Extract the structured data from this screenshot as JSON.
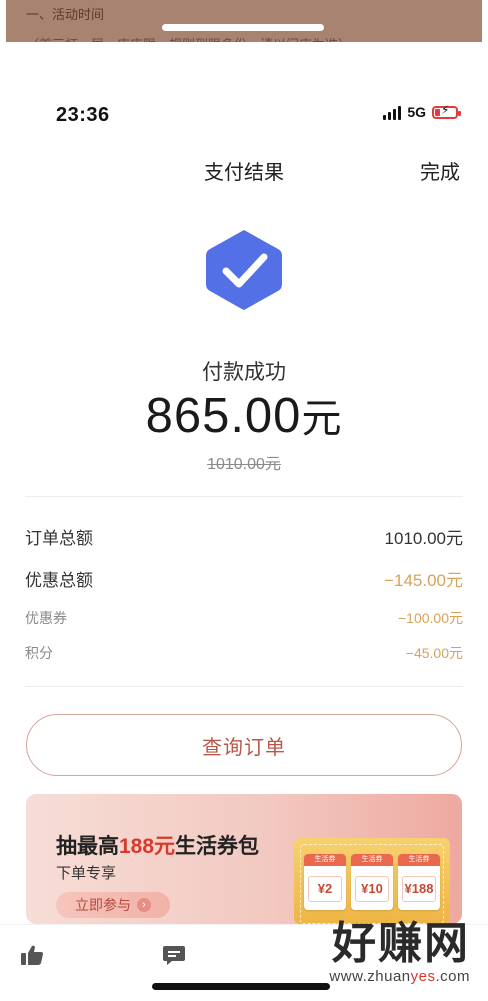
{
  "background_page": {
    "line1": "一、活动时间",
    "line2": "（首三杯一层，店店限，规则到限多份，请以门店为准）"
  },
  "status_bar": {
    "time": "23:36",
    "network": "5G"
  },
  "nav": {
    "title": "支付结果",
    "done": "完成"
  },
  "payment": {
    "status": "付款成功",
    "amount": "865.00",
    "unit": "元",
    "original": "1010.00元"
  },
  "details": [
    {
      "label": "订单总额",
      "value": "1010.00元"
    },
    {
      "label": "优惠总额",
      "value": "−145.00元"
    },
    {
      "label": "优惠券",
      "value": "−100.00元"
    },
    {
      "label": "积分",
      "value": "−45.00元"
    }
  ],
  "query_button": "查询订单",
  "promo": {
    "title_pre": "抽最高",
    "title_highlight": "188元",
    "title_post": "生活券包",
    "subtitle": "下单专享",
    "button": "立即参与",
    "coupons": [
      {
        "top": "生活券",
        "value": "¥2"
      },
      {
        "top": "生活券",
        "value": "¥10"
      },
      {
        "top": "生活券",
        "value": "¥188"
      }
    ]
  },
  "watermark": {
    "main": "好赚网",
    "url_pre": "www.zhuan",
    "url_red": "yes",
    "url_post": ".com"
  },
  "colors": {
    "accent_blue": "#5470e6",
    "discount_gold": "#d7a25a",
    "button_red": "#b7584a"
  },
  "icons": [
    "check-shield-icon",
    "thumbs-up-icon",
    "comment-icon",
    "signal-icon",
    "battery-icon",
    "arrow-right-icon"
  ]
}
